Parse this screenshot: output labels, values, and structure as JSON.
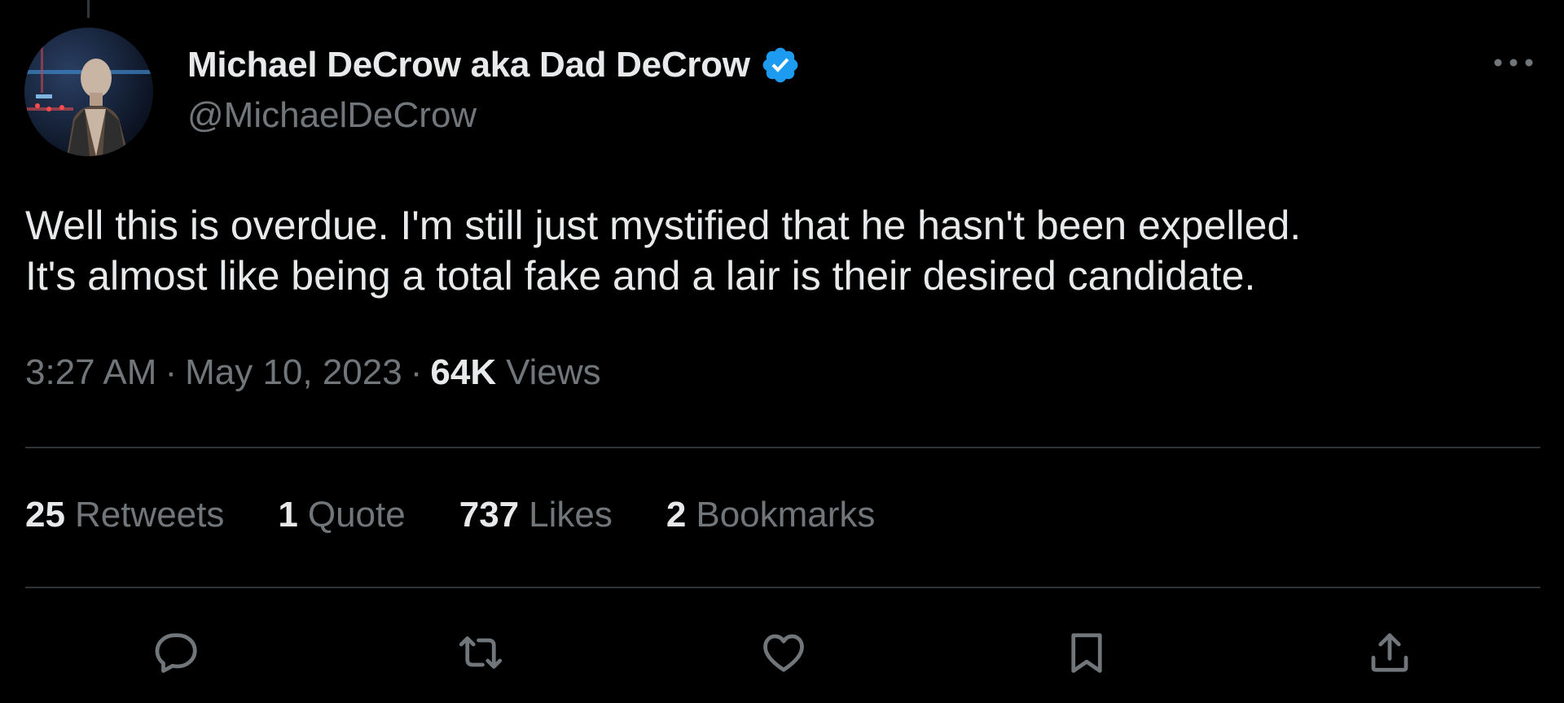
{
  "tweet": {
    "author": {
      "display_name": "Michael DeCrow aka Dad DeCrow",
      "handle": "@MichaelDeCrow",
      "verified": true
    },
    "text_lines": [
      "Well this is overdue. I'm still just mystified that he hasn't been expelled.",
      "It's almost like being a total fake and a lair is their desired candidate."
    ],
    "meta": {
      "time": "3:27 AM",
      "separator": "·",
      "date": "May 10, 2023",
      "views_count": "64K",
      "views_label": "Views"
    },
    "stats": [
      {
        "count": "25",
        "label": "Retweets"
      },
      {
        "count": "1",
        "label": "Quote"
      },
      {
        "count": "737",
        "label": "Likes"
      },
      {
        "count": "2",
        "label": "Bookmarks"
      }
    ],
    "actions": [
      "reply-icon",
      "retweet-icon",
      "like-icon",
      "bookmark-icon",
      "share-icon"
    ]
  },
  "colors": {
    "background": "#000000",
    "primary_text": "#e7e9ea",
    "secondary_text": "#71767b",
    "divider": "#2f3336",
    "verified_blue": "#1d9bf0"
  }
}
